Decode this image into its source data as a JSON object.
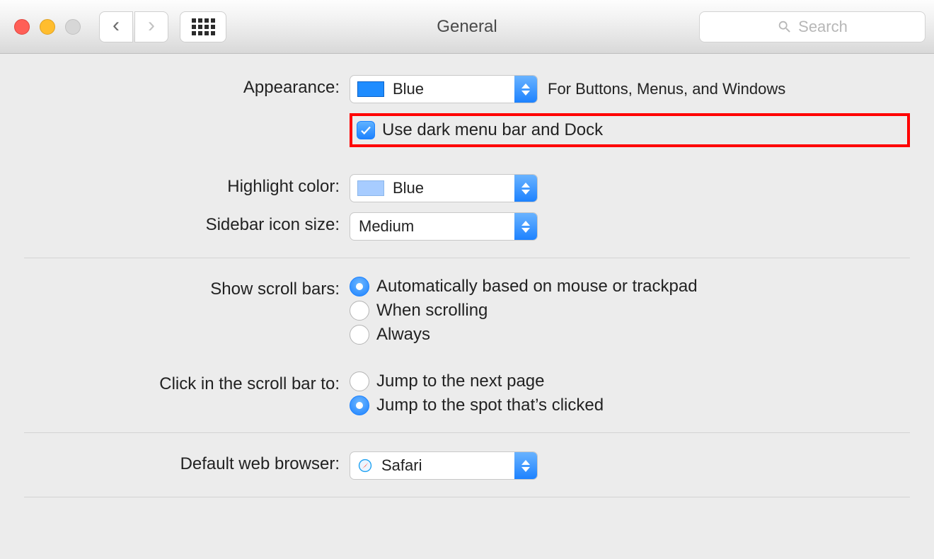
{
  "titlebar": {
    "title": "General",
    "search_placeholder": "Search"
  },
  "appearance": {
    "label": "Appearance:",
    "value": "Blue",
    "helper": "For Buttons, Menus, and Windows",
    "dark_menu_label": "Use dark menu bar and Dock"
  },
  "highlight": {
    "label": "Highlight color:",
    "value": "Blue"
  },
  "sidebar_icon": {
    "label": "Sidebar icon size:",
    "value": "Medium"
  },
  "scrollbars": {
    "label": "Show scroll bars:",
    "options": {
      "auto": "Automatically based on mouse or trackpad",
      "when": "When scrolling",
      "always": "Always"
    }
  },
  "click_scroll": {
    "label": "Click in the scroll bar to:",
    "options": {
      "next": "Jump to the next page",
      "spot": "Jump to the spot that’s clicked"
    }
  },
  "browser": {
    "label": "Default web browser:",
    "value": "Safari"
  }
}
